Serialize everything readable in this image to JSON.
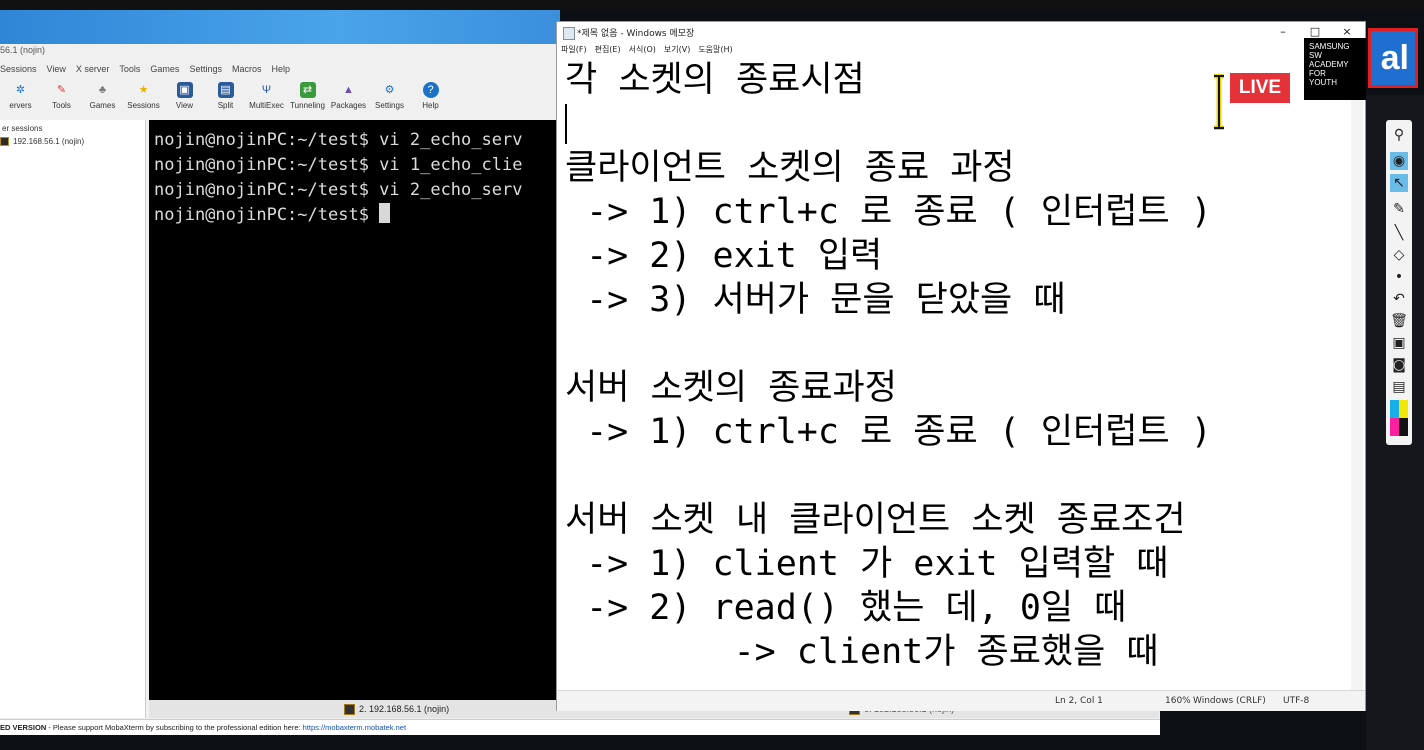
{
  "moba": {
    "window_title": "56.1 (nojin)",
    "menu": [
      "Sessions",
      "View",
      "X server",
      "Tools",
      "Games",
      "Settings",
      "Macros",
      "Help"
    ],
    "toolbar": [
      {
        "label": "ervers",
        "icon": "servers-icon"
      },
      {
        "label": "Tools",
        "icon": "tools-icon"
      },
      {
        "label": "Games",
        "icon": "games-icon"
      },
      {
        "label": "Sessions",
        "icon": "star-icon"
      },
      {
        "label": "View",
        "icon": "view-icon"
      },
      {
        "label": "Split",
        "icon": "split-icon"
      },
      {
        "label": "MultiExec",
        "icon": "multiexec-icon"
      },
      {
        "label": "Tunneling",
        "icon": "tunneling-icon"
      },
      {
        "label": "Packages",
        "icon": "packages-icon"
      },
      {
        "label": "Settings",
        "icon": "settings-icon"
      },
      {
        "label": "Help",
        "icon": "help-icon"
      }
    ],
    "sidebar": {
      "header": "er sessions",
      "session": "192.168.56.1 (nojin)"
    },
    "terminal": {
      "lines": [
        "nojin@nojinPC:~/test$ vi 2_echo_serv",
        "nojin@nojinPC:~/test$ vi 1_echo_clie",
        "nojin@nojinPC:~/test$ vi 2_echo_serv",
        "nojin@nojinPC:~/test$ "
      ]
    },
    "tabs": [
      "2. 192.168.56.1 (nojin)",
      "6. 192.168.56.1 (nojin)"
    ],
    "status": {
      "prefix": "ED VERSION",
      "message": " -  Please support MobaXterm by subscribing to the professional edition here: ",
      "link": "https://mobaxterm.mobatek.net"
    }
  },
  "notepad": {
    "title": "*제목 없음 - Windows 메모장",
    "window_buttons": [
      "–",
      "□",
      "×"
    ],
    "menu": [
      "파일(F)",
      "편집(E)",
      "서식(O)",
      "보기(V)",
      "도움말(H)"
    ],
    "lines": [
      "각 소켓의 종료시점",
      "",
      "클라이언트 소켓의 종료 과정",
      " -> 1) ctrl+c 로 종료 ( 인터럽트 )",
      " -> 2) exit 입력",
      " -> 3) 서버가 문을 닫았을 때",
      "",
      "서버 소켓의 종료과정",
      " -> 1) ctrl+c 로 종료 ( 인터럽트 )",
      "",
      "서버 소켓 내 클라이언트 소켓 종료조건",
      " -> 1) client 가 exit 입력할 때",
      " -> 2) read() 했는 데, 0일 때",
      "        -> client가 종료했을 때"
    ],
    "status": {
      "position": "Ln 2, Col 1",
      "zoom": "160%",
      "line_ending": "Windows (CRLF)",
      "encoding": "UTF-8"
    }
  },
  "overlay": {
    "live": "LIVE",
    "samsung": [
      "SAMSUNG",
      "SW",
      "ACADEMY",
      "FOR",
      "YOUTH"
    ],
    "logo_fragment": "al"
  }
}
